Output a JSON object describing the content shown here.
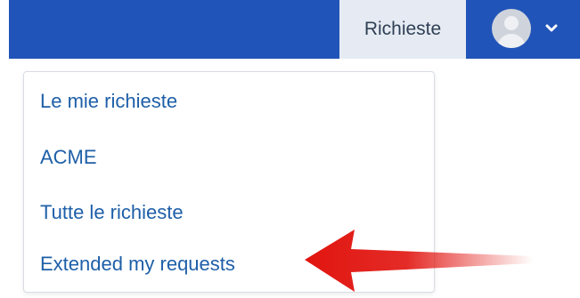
{
  "header": {
    "nav_tab_label": "Richieste",
    "avatar_icon": "user-avatar-icon",
    "chevron_icon": "chevron-down-icon"
  },
  "menu": {
    "items": [
      {
        "label": "Le mie richieste"
      },
      {
        "label": "ACME"
      },
      {
        "label": "Tutte le richieste"
      },
      {
        "label": "Extended my requests"
      }
    ]
  },
  "annotation": {
    "arrow_icon": "red-pointer-arrow-icon",
    "arrow_color": "#e1140f"
  },
  "colors": {
    "topbar": "#2154b8",
    "active_tab": "#e6ebf3",
    "link": "#1e5fa8"
  }
}
